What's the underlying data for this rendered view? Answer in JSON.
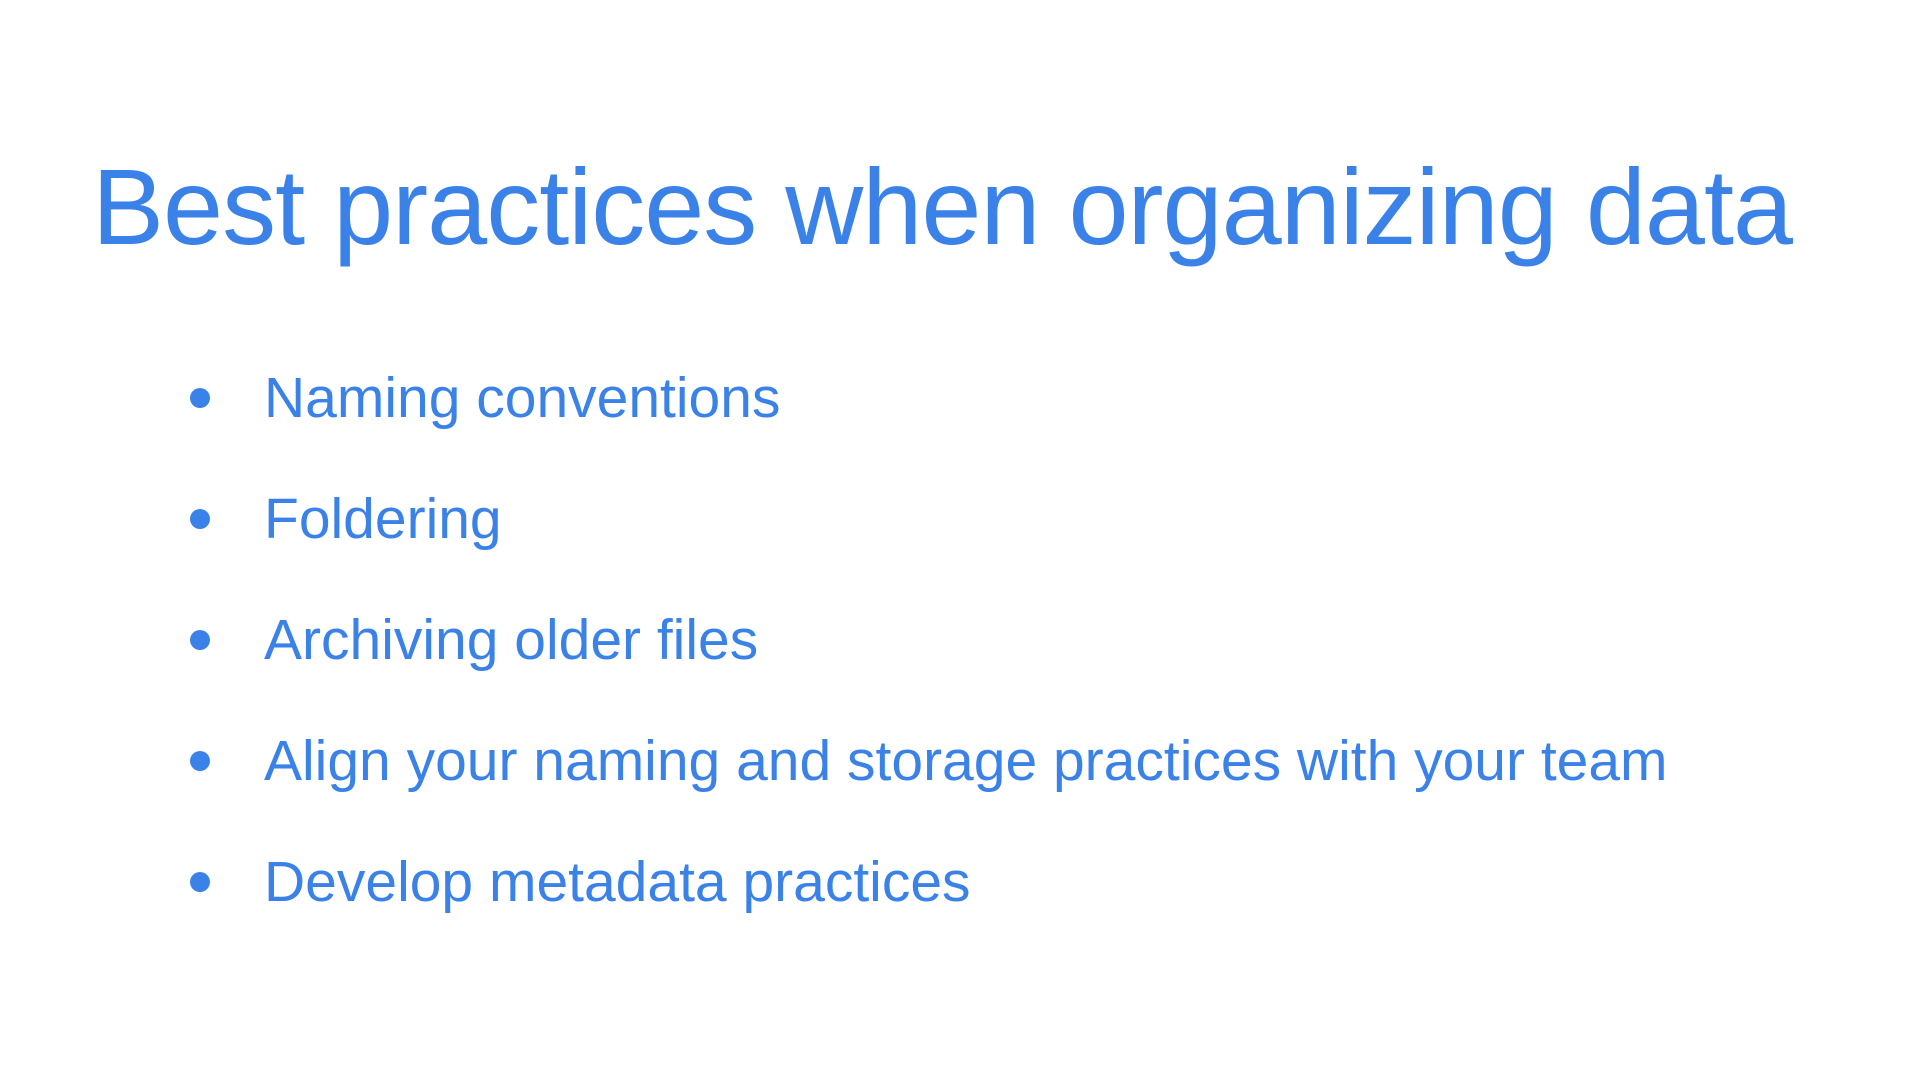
{
  "colors": {
    "accent": "#3b82e8",
    "background": "#ffffff"
  },
  "slide": {
    "title": "Best practices when organizing data",
    "bullets": [
      "Naming conventions",
      "Foldering",
      "Archiving older files",
      "Align your naming and storage practices with your team",
      "Develop metadata practices"
    ]
  }
}
